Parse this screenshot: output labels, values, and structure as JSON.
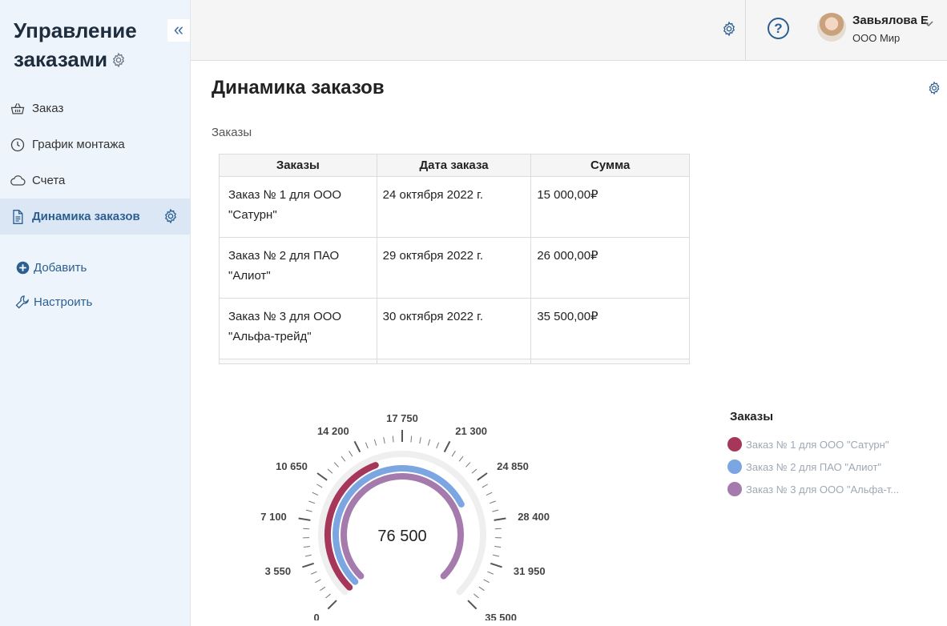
{
  "sidebar": {
    "title_line1": "Управление",
    "title_line2": "заказами",
    "collapse_glyph": "«",
    "nav": [
      {
        "label": "Заказ",
        "icon": "basket-icon"
      },
      {
        "label": "График монтажа",
        "icon": "clock-icon"
      },
      {
        "label": "Счета",
        "icon": "cloud-icon"
      },
      {
        "label": "Динамика заказов",
        "icon": "document-icon",
        "active": true
      }
    ],
    "actions": [
      {
        "label": "Добавить",
        "icon": "plus-circle-icon"
      },
      {
        "label": "Настроить",
        "icon": "wrench-icon"
      }
    ]
  },
  "header": {
    "help_glyph": "?",
    "user_name": "Завьялова Е",
    "user_org": "ООО Мир"
  },
  "main": {
    "title": "Динамика заказов",
    "section_label": "Заказы",
    "table": {
      "headers": [
        "Заказы",
        "Дата заказа",
        "Сумма"
      ],
      "rows": [
        {
          "order_line1": "Заказ № 1 для ООО",
          "order_line2": "\"Сатурн\"",
          "date": "24 октября 2022 г.",
          "sum": "15 000,00₽"
        },
        {
          "order_line1": "Заказ № 2 для ПАО",
          "order_line2": "\"Алиот\"",
          "date": "29 октября 2022 г.",
          "sum": "26 000,00₽"
        },
        {
          "order_line1": "Заказ № 3 для ООО",
          "order_line2": "\"Альфа-трейд\"",
          "date": "30 октября 2022 г.",
          "sum": "35 500,00₽"
        }
      ]
    }
  },
  "chart_data": {
    "type": "radial-gauge",
    "total_label": "76 500",
    "scale_min": 0,
    "scale_max": 35500,
    "tick_labels": [
      "0",
      "3 550",
      "7 100",
      "10 650",
      "14 200",
      "17 750",
      "21 300",
      "24 850",
      "28 400",
      "31 950",
      "35 500"
    ],
    "legend_title": "Заказы",
    "series": [
      {
        "name": "Заказ № 1 для ООО \"Сатурн\"",
        "value": 15000,
        "color": "#a6365a"
      },
      {
        "name": "Заказ № 2 для ПАО \"Алиот\"",
        "value": 26000,
        "color": "#7ba6e1"
      },
      {
        "name": "Заказ № 3 для ООО \"Альфа-т...",
        "value": 35500,
        "color": "#a57aad"
      }
    ]
  },
  "colors": {
    "accent": "#2c5e91",
    "sidebar_bg": "#eef4fb",
    "active_bg": "#dbe7f4"
  }
}
